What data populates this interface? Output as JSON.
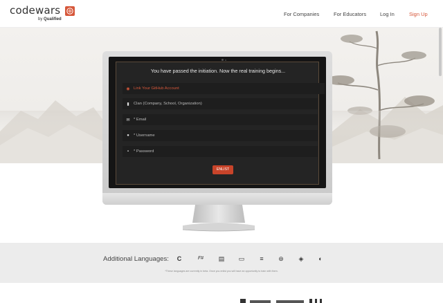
{
  "header": {
    "logo_text": "codewars",
    "logo_sub_prefix": "by ",
    "logo_sub_brand": "Qualified",
    "nav": [
      "For Companies",
      "For Educators",
      "Log In",
      "Sign Up"
    ]
  },
  "form": {
    "title": "You have passed the initiation. Now the real training begins...",
    "github_label": "Link Your GitHub Account",
    "fields": [
      {
        "icon": "building-icon",
        "placeholder": "Clan (Company, School, Organization)"
      },
      {
        "icon": "envelope-icon",
        "placeholder": "* Email"
      },
      {
        "icon": "user-icon",
        "placeholder": "* Username"
      },
      {
        "icon": "lock-icon",
        "placeholder": "* Password"
      }
    ],
    "submit_label": "ENLIST"
  },
  "languages": {
    "label": "Additional Languages:",
    "icons": [
      "c-icon",
      "fsharp-icon",
      "language-icon-3",
      "language-icon-4",
      "language-icon-5",
      "language-icon-6",
      "language-icon-7",
      "language-icon-8"
    ],
    "note": "*These languages are currently in beta. Once you enlist you will have an opportunity to train with them."
  },
  "colors": {
    "accent": "#d6573a",
    "button": "#c8442a",
    "screen": "#151515"
  }
}
